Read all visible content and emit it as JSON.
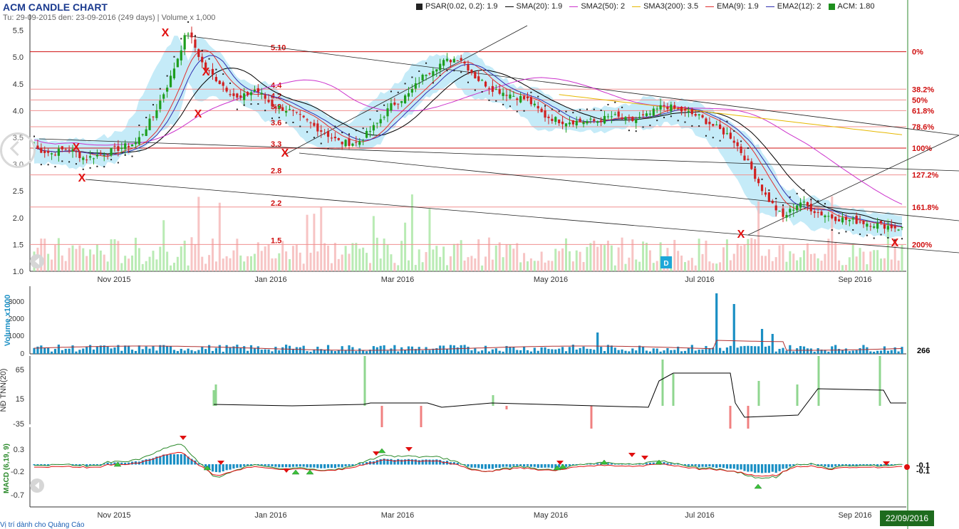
{
  "header": {
    "title": "ACM CANDLE CHART",
    "subtitle": "Tu: 29-09-2015 den: 23-09-2016 (249 days) | Volume x 1,000"
  },
  "legend": [
    {
      "label": "PSAR(0.02, 0.2): 1.9",
      "color": "#222222",
      "kind": "square"
    },
    {
      "label": "SMA(20): 1.9",
      "color": "#000000",
      "kind": "line"
    },
    {
      "label": "SMA2(50): 2",
      "color": "#cc33cc",
      "kind": "line"
    },
    {
      "label": "SMA3(200): 3.5",
      "color": "#e6b800",
      "kind": "line"
    },
    {
      "label": "EMA(9): 1.9",
      "color": "#e03030",
      "kind": "line"
    },
    {
      "label": "EMA2(12): 2",
      "color": "#3030b0",
      "kind": "line"
    },
    {
      "label": "ACM: 1.80",
      "color": "#1e8f1e",
      "kind": "square"
    }
  ],
  "footer": {
    "ad_text": "Vị trí dành cho Quảng Cáo",
    "last_date": "22/09/2016"
  },
  "chart_data": [
    {
      "type": "candlestick",
      "title": "ACM CANDLE CHART",
      "x_labels": [
        "Nov 2015",
        "Jan 2016",
        "Mar 2016",
        "May 2016",
        "Jul 2016",
        "Sep 2016"
      ],
      "ylim": [
        1.0,
        5.8
      ],
      "y_ticks": [
        "1.0",
        "1.5",
        "2.0",
        "2.5",
        "3.0",
        "3.5",
        "4.0",
        "4.5",
        "5.0",
        "5.5"
      ],
      "grid": false,
      "close_path": [
        3.3,
        3.2,
        3.3,
        3.1,
        3.2,
        3.3,
        3.4,
        3.9,
        4.6,
        5.5,
        4.8,
        4.5,
        4.2,
        4.4,
        4.1,
        4.0,
        3.8,
        3.6,
        3.4,
        3.4,
        3.7,
        4.1,
        4.3,
        4.7,
        4.9,
        5.0,
        4.6,
        4.4,
        4.3,
        4.2,
        3.9,
        3.8,
        3.8,
        3.8,
        3.9,
        3.8,
        3.9,
        4.1,
        4.0,
        3.9,
        3.7,
        3.5,
        3.0,
        2.4,
        2.0,
        2.3,
        2.1,
        2.0,
        1.95,
        1.9,
        1.85,
        1.8
      ],
      "fib_levels": [
        {
          "label": "5.10",
          "pct": "0%",
          "value": 5.1
        },
        {
          "label": "4.4",
          "pct": "38.2%",
          "value": 4.4
        },
        {
          "label": "4.2",
          "pct": "50%",
          "value": 4.2
        },
        {
          "label": "3.9",
          "pct": "61.8%",
          "value": 4.0
        },
        {
          "label": "3.6",
          "pct": "78.6%",
          "value": 3.7
        },
        {
          "label": "3.3",
          "pct": "100%",
          "value": 3.3
        },
        {
          "label": "2.8",
          "pct": "127.2%",
          "value": 2.8
        },
        {
          "label": "2.2",
          "pct": "161.8%",
          "value": 2.2
        },
        {
          "label": "1.5",
          "pct": "200%",
          "value": 1.5
        }
      ],
      "marker_D": "D",
      "x_markers": [
        "X",
        "X",
        "X",
        "X",
        "X",
        "X",
        "X",
        "X"
      ]
    },
    {
      "type": "bar",
      "ylabel": "Volume x1000",
      "y_ticks": [
        "0",
        "1000",
        "2000",
        "3000"
      ],
      "last_value": "266"
    },
    {
      "type": "bar",
      "ylabel": "NĐ TNN(20)",
      "y_ticks": [
        "65",
        "15",
        "-35"
      ]
    },
    {
      "type": "line",
      "ylabel": "MACD (6,19, 9)",
      "y_ticks": [
        "0.3",
        "-0.2",
        "-0.7"
      ],
      "last_values": [
        "-0.1",
        "-0.1"
      ]
    }
  ]
}
